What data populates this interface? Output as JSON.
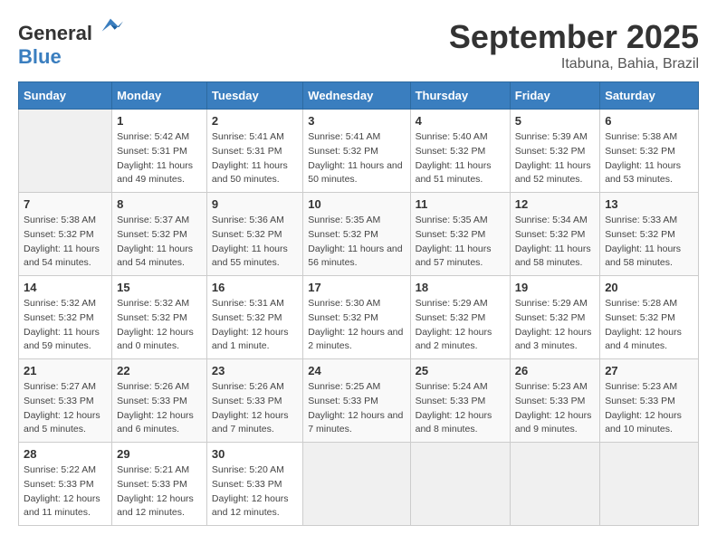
{
  "logo": {
    "general": "General",
    "blue": "Blue"
  },
  "title": "September 2025",
  "subtitle": "Itabuna, Bahia, Brazil",
  "days_of_week": [
    "Sunday",
    "Monday",
    "Tuesday",
    "Wednesday",
    "Thursday",
    "Friday",
    "Saturday"
  ],
  "weeks": [
    [
      {
        "day": "",
        "sunrise": "",
        "sunset": "",
        "daylight": "",
        "empty": true
      },
      {
        "day": "1",
        "sunrise": "Sunrise: 5:42 AM",
        "sunset": "Sunset: 5:31 PM",
        "daylight": "Daylight: 11 hours and 49 minutes."
      },
      {
        "day": "2",
        "sunrise": "Sunrise: 5:41 AM",
        "sunset": "Sunset: 5:31 PM",
        "daylight": "Daylight: 11 hours and 50 minutes."
      },
      {
        "day": "3",
        "sunrise": "Sunrise: 5:41 AM",
        "sunset": "Sunset: 5:32 PM",
        "daylight": "Daylight: 11 hours and 50 minutes."
      },
      {
        "day": "4",
        "sunrise": "Sunrise: 5:40 AM",
        "sunset": "Sunset: 5:32 PM",
        "daylight": "Daylight: 11 hours and 51 minutes."
      },
      {
        "day": "5",
        "sunrise": "Sunrise: 5:39 AM",
        "sunset": "Sunset: 5:32 PM",
        "daylight": "Daylight: 11 hours and 52 minutes."
      },
      {
        "day": "6",
        "sunrise": "Sunrise: 5:38 AM",
        "sunset": "Sunset: 5:32 PM",
        "daylight": "Daylight: 11 hours and 53 minutes."
      }
    ],
    [
      {
        "day": "7",
        "sunrise": "Sunrise: 5:38 AM",
        "sunset": "Sunset: 5:32 PM",
        "daylight": "Daylight: 11 hours and 54 minutes."
      },
      {
        "day": "8",
        "sunrise": "Sunrise: 5:37 AM",
        "sunset": "Sunset: 5:32 PM",
        "daylight": "Daylight: 11 hours and 54 minutes."
      },
      {
        "day": "9",
        "sunrise": "Sunrise: 5:36 AM",
        "sunset": "Sunset: 5:32 PM",
        "daylight": "Daylight: 11 hours and 55 minutes."
      },
      {
        "day": "10",
        "sunrise": "Sunrise: 5:35 AM",
        "sunset": "Sunset: 5:32 PM",
        "daylight": "Daylight: 11 hours and 56 minutes."
      },
      {
        "day": "11",
        "sunrise": "Sunrise: 5:35 AM",
        "sunset": "Sunset: 5:32 PM",
        "daylight": "Daylight: 11 hours and 57 minutes."
      },
      {
        "day": "12",
        "sunrise": "Sunrise: 5:34 AM",
        "sunset": "Sunset: 5:32 PM",
        "daylight": "Daylight: 11 hours and 58 minutes."
      },
      {
        "day": "13",
        "sunrise": "Sunrise: 5:33 AM",
        "sunset": "Sunset: 5:32 PM",
        "daylight": "Daylight: 11 hours and 58 minutes."
      }
    ],
    [
      {
        "day": "14",
        "sunrise": "Sunrise: 5:32 AM",
        "sunset": "Sunset: 5:32 PM",
        "daylight": "Daylight: 11 hours and 59 minutes."
      },
      {
        "day": "15",
        "sunrise": "Sunrise: 5:32 AM",
        "sunset": "Sunset: 5:32 PM",
        "daylight": "Daylight: 12 hours and 0 minutes."
      },
      {
        "day": "16",
        "sunrise": "Sunrise: 5:31 AM",
        "sunset": "Sunset: 5:32 PM",
        "daylight": "Daylight: 12 hours and 1 minute."
      },
      {
        "day": "17",
        "sunrise": "Sunrise: 5:30 AM",
        "sunset": "Sunset: 5:32 PM",
        "daylight": "Daylight: 12 hours and 2 minutes."
      },
      {
        "day": "18",
        "sunrise": "Sunrise: 5:29 AM",
        "sunset": "Sunset: 5:32 PM",
        "daylight": "Daylight: 12 hours and 2 minutes."
      },
      {
        "day": "19",
        "sunrise": "Sunrise: 5:29 AM",
        "sunset": "Sunset: 5:32 PM",
        "daylight": "Daylight: 12 hours and 3 minutes."
      },
      {
        "day": "20",
        "sunrise": "Sunrise: 5:28 AM",
        "sunset": "Sunset: 5:32 PM",
        "daylight": "Daylight: 12 hours and 4 minutes."
      }
    ],
    [
      {
        "day": "21",
        "sunrise": "Sunrise: 5:27 AM",
        "sunset": "Sunset: 5:33 PM",
        "daylight": "Daylight: 12 hours and 5 minutes."
      },
      {
        "day": "22",
        "sunrise": "Sunrise: 5:26 AM",
        "sunset": "Sunset: 5:33 PM",
        "daylight": "Daylight: 12 hours and 6 minutes."
      },
      {
        "day": "23",
        "sunrise": "Sunrise: 5:26 AM",
        "sunset": "Sunset: 5:33 PM",
        "daylight": "Daylight: 12 hours and 7 minutes."
      },
      {
        "day": "24",
        "sunrise": "Sunrise: 5:25 AM",
        "sunset": "Sunset: 5:33 PM",
        "daylight": "Daylight: 12 hours and 7 minutes."
      },
      {
        "day": "25",
        "sunrise": "Sunrise: 5:24 AM",
        "sunset": "Sunset: 5:33 PM",
        "daylight": "Daylight: 12 hours and 8 minutes."
      },
      {
        "day": "26",
        "sunrise": "Sunrise: 5:23 AM",
        "sunset": "Sunset: 5:33 PM",
        "daylight": "Daylight: 12 hours and 9 minutes."
      },
      {
        "day": "27",
        "sunrise": "Sunrise: 5:23 AM",
        "sunset": "Sunset: 5:33 PM",
        "daylight": "Daylight: 12 hours and 10 minutes."
      }
    ],
    [
      {
        "day": "28",
        "sunrise": "Sunrise: 5:22 AM",
        "sunset": "Sunset: 5:33 PM",
        "daylight": "Daylight: 12 hours and 11 minutes."
      },
      {
        "day": "29",
        "sunrise": "Sunrise: 5:21 AM",
        "sunset": "Sunset: 5:33 PM",
        "daylight": "Daylight: 12 hours and 12 minutes."
      },
      {
        "day": "30",
        "sunrise": "Sunrise: 5:20 AM",
        "sunset": "Sunset: 5:33 PM",
        "daylight": "Daylight: 12 hours and 12 minutes."
      },
      {
        "day": "",
        "sunrise": "",
        "sunset": "",
        "daylight": "",
        "empty": true
      },
      {
        "day": "",
        "sunrise": "",
        "sunset": "",
        "daylight": "",
        "empty": true
      },
      {
        "day": "",
        "sunrise": "",
        "sunset": "",
        "daylight": "",
        "empty": true
      },
      {
        "day": "",
        "sunrise": "",
        "sunset": "",
        "daylight": "",
        "empty": true
      }
    ]
  ]
}
